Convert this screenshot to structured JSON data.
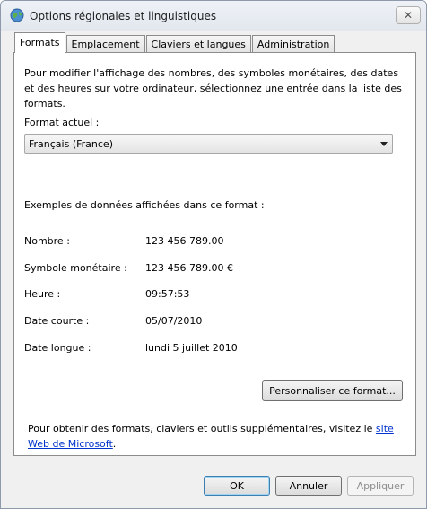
{
  "window": {
    "title": "Options régionales et linguistiques",
    "close_glyph": "✕"
  },
  "tabs": [
    {
      "label": "Formats",
      "active": true
    },
    {
      "label": "Emplacement",
      "active": false
    },
    {
      "label": "Claviers et langues",
      "active": false
    },
    {
      "label": "Administration",
      "active": false
    }
  ],
  "formats": {
    "intro": "Pour modifier l'affichage des nombres, des symboles monétaires, des dates et des heures sur votre ordinateur, sélectionnez une entrée dans la liste des formats.",
    "current_label": "Format actuel :",
    "current_value": "Français (France)",
    "examples_title": "Exemples de données affichées dans ce format :",
    "examples": [
      {
        "label": "Nombre :",
        "value": "123 456 789.00"
      },
      {
        "label": "Symbole monétaire :",
        "value": "123 456 789.00 €"
      },
      {
        "label": "Heure :",
        "value": "09:57:53"
      },
      {
        "label": "Date courte :",
        "value": "05/07/2010"
      },
      {
        "label": "Date longue :",
        "value": "lundi 5 juillet 2010"
      }
    ],
    "customize_label": "Personnaliser ce format...",
    "more_text": "Pour obtenir des formats, claviers et outils supplémentaires, visitez le ",
    "more_link": "site Web de Microsoft",
    "more_end": "."
  },
  "buttons": {
    "ok": "OK",
    "cancel": "Annuler",
    "apply": "Appliquer"
  },
  "colors": {
    "link": "#0033cc",
    "dialog_bg": "#f0f0f0"
  }
}
